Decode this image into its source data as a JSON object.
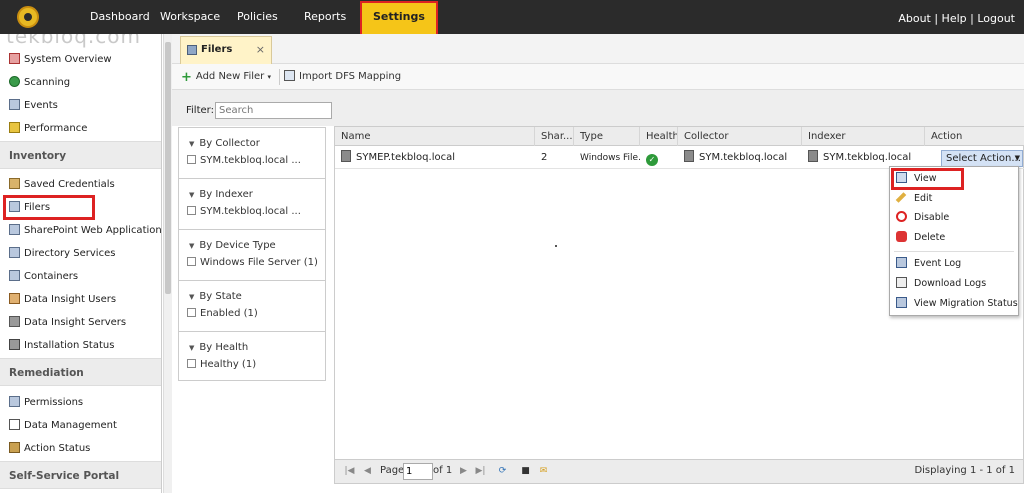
{
  "nav": {
    "items": [
      "Dashboard",
      "Workspace",
      "Policies",
      "Reports",
      "Settings"
    ],
    "active": "Settings",
    "right_links": "About | Help | Logout"
  },
  "watermark": "tekbloq.com",
  "sidebar": {
    "top_items": [
      "System Overview",
      "Scanning",
      "Events",
      "Performance"
    ],
    "sections": [
      {
        "title": "Inventory",
        "items": [
          "Saved Credentials",
          "Filers",
          "SharePoint Web Applications",
          "Directory Services",
          "Containers",
          "Data Insight Users",
          "Data Insight Servers",
          "Installation Status"
        ]
      },
      {
        "title": "Remediation",
        "items": [
          "Permissions",
          "Data Management",
          "Action Status"
        ]
      },
      {
        "title": "Self-Service Portal",
        "items": []
      }
    ]
  },
  "tab": {
    "label": "Filers",
    "close": "×"
  },
  "toolbar": {
    "add_label": "Add New Filer",
    "import_label": "Import DFS Mapping"
  },
  "filter": {
    "label": "Filter:",
    "placeholder": "Search"
  },
  "facets": [
    {
      "title": "By Collector",
      "option": "SYM.tekbloq.local ..."
    },
    {
      "title": "By Indexer",
      "option": "SYM.tekbloq.local ..."
    },
    {
      "title": "By Device Type",
      "option": "Windows File Server (1)"
    },
    {
      "title": "By State",
      "option": "Enabled (1)"
    },
    {
      "title": "By Health",
      "option": "Healthy (1)"
    }
  ],
  "grid": {
    "headers": [
      "Name",
      "Shar...",
      "Type",
      "Health",
      "Collector",
      "Indexer",
      "Action"
    ],
    "rows": [
      {
        "name": "SYMEP.tekbloq.local",
        "shares": "2",
        "type": "Windows File...",
        "health": "✓",
        "collector": "SYM.tekbloq.local",
        "indexer": "SYM.tekbloq.local",
        "action": "Select Action..."
      }
    ]
  },
  "pager": {
    "page_label": "Page",
    "page_value": "1",
    "of_label": "of 1",
    "displaying": "Displaying 1 - 1 of 1"
  },
  "menu": {
    "items": [
      "View",
      "Edit",
      "Disable",
      "Delete"
    ],
    "items2": [
      "Event Log",
      "Download Logs",
      "View Migration Status"
    ]
  },
  "colors": {
    "nav_bg": "#2b2b2b",
    "active_tab": "#f5c518",
    "highlight": "#d22222",
    "health_ok": "#2e9a3a"
  }
}
